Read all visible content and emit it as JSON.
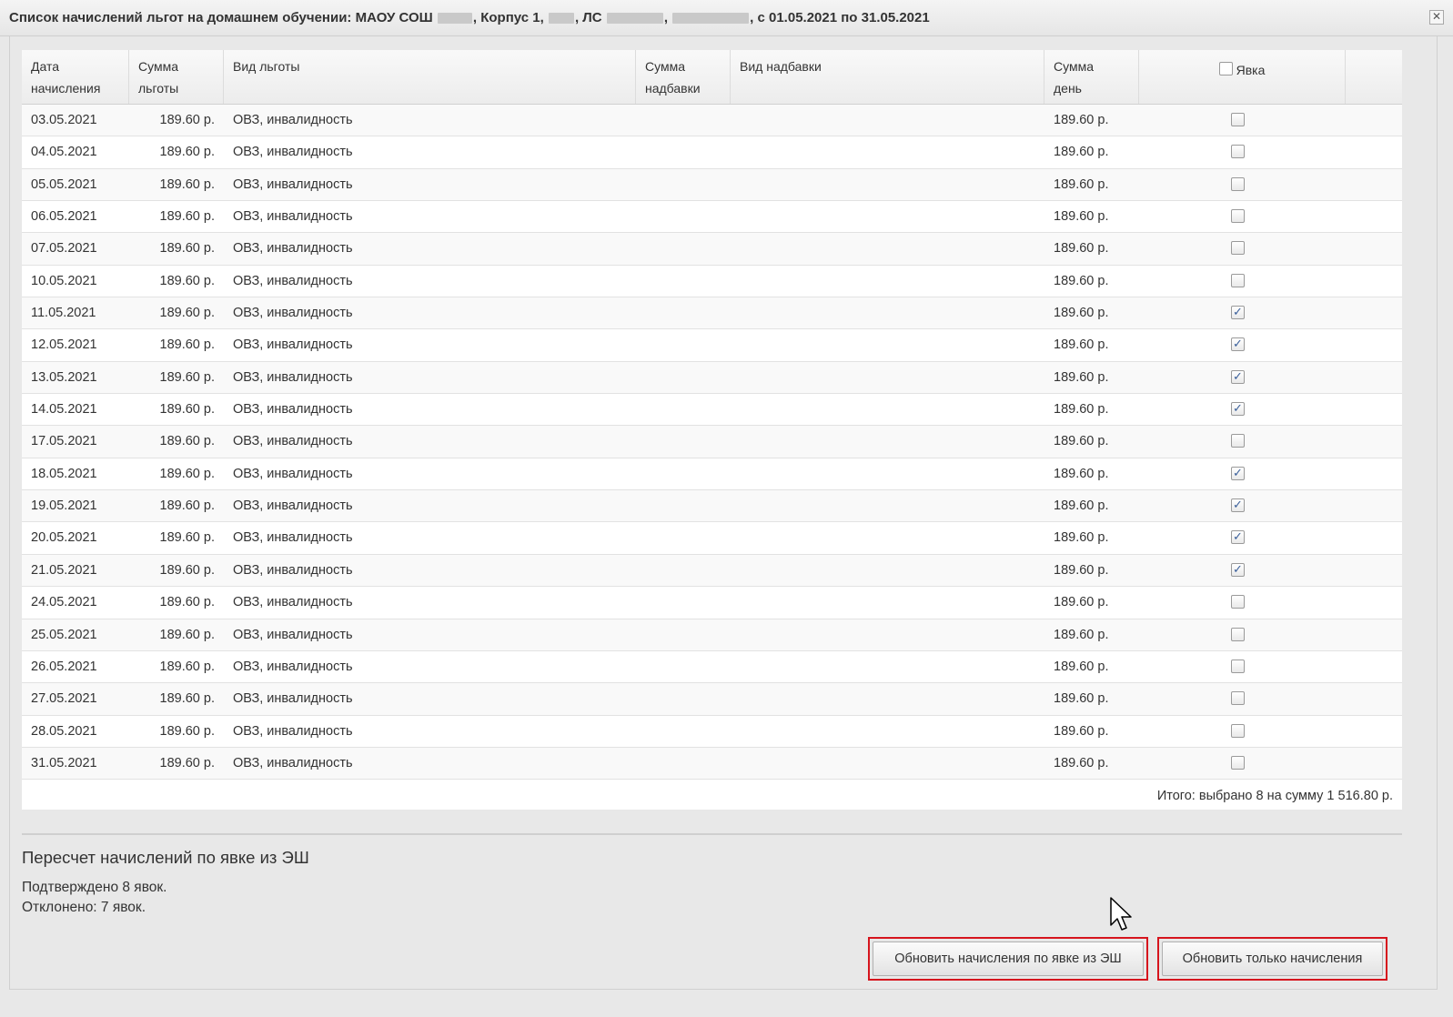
{
  "window": {
    "title_parts": [
      "Список начислений льгот на домашнем обучении: МАОУ СОШ",
      ", Корпус 1,",
      ", ЛС",
      ",",
      ", с 01.05.2021 по 31.05.2021"
    ],
    "close_glyph": "✕"
  },
  "table": {
    "headers": {
      "date_line1": "Дата",
      "date_line2": "начисления",
      "sum_line1": "Сумма",
      "sum_line2": "льготы",
      "benefit_type": "Вид льготы",
      "bonus_sum_line1": "Сумма",
      "bonus_sum_line2": "надбавки",
      "bonus_type": "Вид надбавки",
      "day_sum_line1": "Сумма",
      "day_sum_line2": "день",
      "attendance": "Явка"
    },
    "rows": [
      {
        "date": "03.05.2021",
        "sum": "189.60 р.",
        "type": "ОВЗ, инвалидность",
        "day_sum": "189.60 р.",
        "attended": false
      },
      {
        "date": "04.05.2021",
        "sum": "189.60 р.",
        "type": "ОВЗ, инвалидность",
        "day_sum": "189.60 р.",
        "attended": false
      },
      {
        "date": "05.05.2021",
        "sum": "189.60 р.",
        "type": "ОВЗ, инвалидность",
        "day_sum": "189.60 р.",
        "attended": false
      },
      {
        "date": "06.05.2021",
        "sum": "189.60 р.",
        "type": "ОВЗ, инвалидность",
        "day_sum": "189.60 р.",
        "attended": false
      },
      {
        "date": "07.05.2021",
        "sum": "189.60 р.",
        "type": "ОВЗ, инвалидность",
        "day_sum": "189.60 р.",
        "attended": false
      },
      {
        "date": "10.05.2021",
        "sum": "189.60 р.",
        "type": "ОВЗ, инвалидность",
        "day_sum": "189.60 р.",
        "attended": false
      },
      {
        "date": "11.05.2021",
        "sum": "189.60 р.",
        "type": "ОВЗ, инвалидность",
        "day_sum": "189.60 р.",
        "attended": true
      },
      {
        "date": "12.05.2021",
        "sum": "189.60 р.",
        "type": "ОВЗ, инвалидность",
        "day_sum": "189.60 р.",
        "attended": true
      },
      {
        "date": "13.05.2021",
        "sum": "189.60 р.",
        "type": "ОВЗ, инвалидность",
        "day_sum": "189.60 р.",
        "attended": true
      },
      {
        "date": "14.05.2021",
        "sum": "189.60 р.",
        "type": "ОВЗ, инвалидность",
        "day_sum": "189.60 р.",
        "attended": true
      },
      {
        "date": "17.05.2021",
        "sum": "189.60 р.",
        "type": "ОВЗ, инвалидность",
        "day_sum": "189.60 р.",
        "attended": false
      },
      {
        "date": "18.05.2021",
        "sum": "189.60 р.",
        "type": "ОВЗ, инвалидность",
        "day_sum": "189.60 р.",
        "attended": true
      },
      {
        "date": "19.05.2021",
        "sum": "189.60 р.",
        "type": "ОВЗ, инвалидность",
        "day_sum": "189.60 р.",
        "attended": true
      },
      {
        "date": "20.05.2021",
        "sum": "189.60 р.",
        "type": "ОВЗ, инвалидность",
        "day_sum": "189.60 р.",
        "attended": true
      },
      {
        "date": "21.05.2021",
        "sum": "189.60 р.",
        "type": "ОВЗ, инвалидность",
        "day_sum": "189.60 р.",
        "attended": true
      },
      {
        "date": "24.05.2021",
        "sum": "189.60 р.",
        "type": "ОВЗ, инвалидность",
        "day_sum": "189.60 р.",
        "attended": false
      },
      {
        "date": "25.05.2021",
        "sum": "189.60 р.",
        "type": "ОВЗ, инвалидность",
        "day_sum": "189.60 р.",
        "attended": false
      },
      {
        "date": "26.05.2021",
        "sum": "189.60 р.",
        "type": "ОВЗ, инвалидность",
        "day_sum": "189.60 р.",
        "attended": false
      },
      {
        "date": "27.05.2021",
        "sum": "189.60 р.",
        "type": "ОВЗ, инвалидность",
        "day_sum": "189.60 р.",
        "attended": false
      },
      {
        "date": "28.05.2021",
        "sum": "189.60 р.",
        "type": "ОВЗ, инвалидность",
        "day_sum": "189.60 р.",
        "attended": false
      },
      {
        "date": "31.05.2021",
        "sum": "189.60 р.",
        "type": "ОВЗ, инвалидность",
        "day_sum": "189.60 р.",
        "attended": false
      }
    ],
    "checked_glyph": "✓",
    "total": "Итого: выбрано 8 на сумму 1 516.80 р."
  },
  "recalc": {
    "title": "Пересчет начислений по явке из ЭШ",
    "confirmed": "Подтверждено 8 явок.",
    "rejected": "Отклонено: 7 явок."
  },
  "buttons": {
    "update_by_attendance": "Обновить начисления по явке из ЭШ",
    "update_only": "Обновить только начисления"
  },
  "colors": {
    "highlight_border": "#d6141d",
    "checkbox_check": "#3a5f9a"
  }
}
